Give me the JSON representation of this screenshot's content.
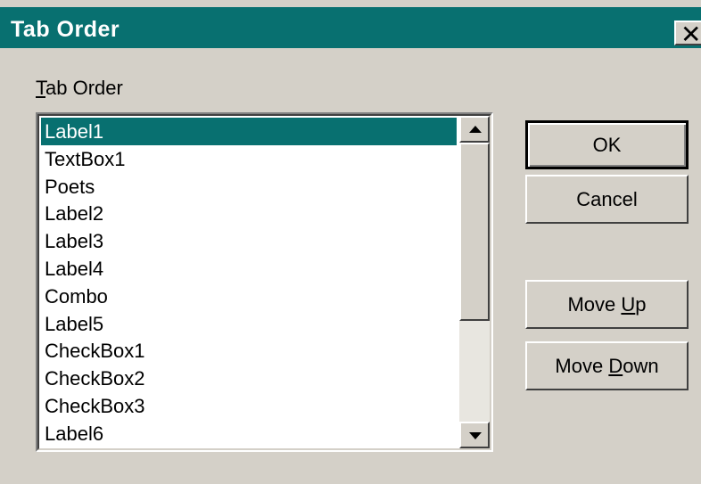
{
  "window": {
    "title": "Tab Order",
    "close_label": "×"
  },
  "group": {
    "label_hotkey": "T",
    "label_rest": "ab Order"
  },
  "listbox": {
    "selected_index": 0,
    "items": [
      "Label1",
      "TextBox1",
      "Poets",
      "Label2",
      "Label3",
      "Label4",
      "Combo",
      "Label5",
      "CheckBox1",
      "CheckBox2",
      "CheckBox3",
      "Label6"
    ]
  },
  "buttons": {
    "ok": "OK",
    "cancel": "Cancel",
    "move_up_prefix": "Move ",
    "move_up_hotkey": "U",
    "move_up_rest": "p",
    "move_down_prefix": "Move ",
    "move_down_hotkey": "D",
    "move_down_rest": "own"
  },
  "colors": {
    "title_bar": "#087070",
    "selection": "#087070",
    "face": "#d4d0c8"
  },
  "icons": {
    "close": "close-icon",
    "scroll_up": "chevron-up-icon",
    "scroll_down": "chevron-down-icon"
  }
}
